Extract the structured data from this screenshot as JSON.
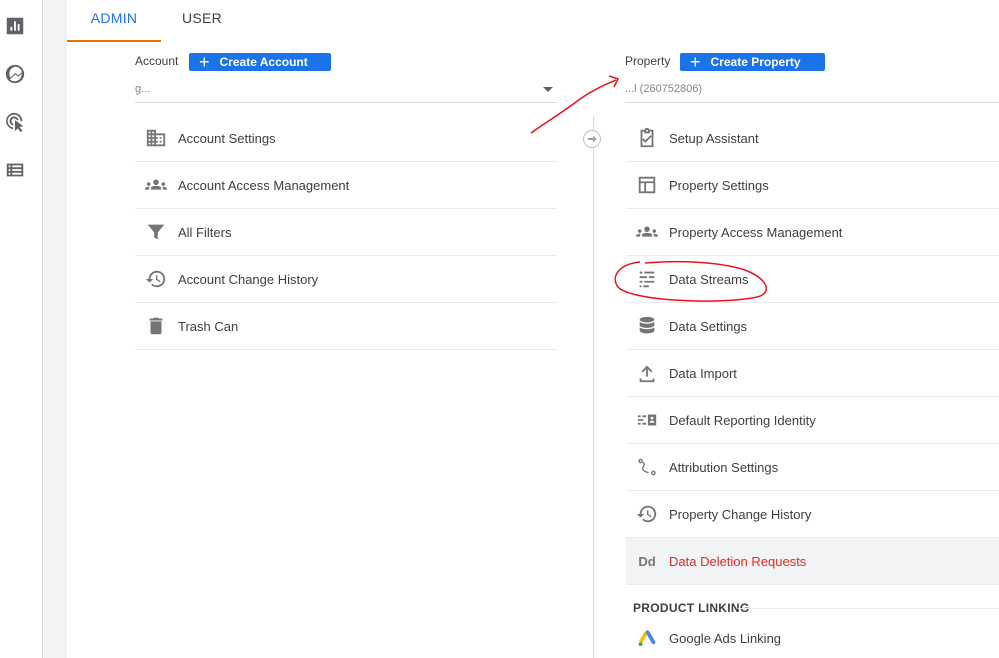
{
  "tabs": {
    "admin": "ADMIN",
    "user": "USER"
  },
  "account": {
    "label": "Account",
    "create_button": "Create Account",
    "selector_value": "g..."
  },
  "property": {
    "label": "Property",
    "create_button": "Create Property",
    "selector_value": "...l (260752806)"
  },
  "account_menu": [
    {
      "label": "Account Settings",
      "icon": "building-icon"
    },
    {
      "label": "Account Access Management",
      "icon": "people-icon"
    },
    {
      "label": "All Filters",
      "icon": "filter-icon"
    },
    {
      "label": "Account Change History",
      "icon": "history-icon"
    },
    {
      "label": "Trash Can",
      "icon": "trash-icon"
    }
  ],
  "property_menu": [
    {
      "label": "Setup Assistant",
      "icon": "checklist-icon"
    },
    {
      "label": "Property Settings",
      "icon": "layout-icon"
    },
    {
      "label": "Property Access Management",
      "icon": "people-icon"
    },
    {
      "label": "Data Streams",
      "icon": "streams-icon"
    },
    {
      "label": "Data Settings",
      "icon": "database-icon"
    },
    {
      "label": "Data Import",
      "icon": "upload-icon"
    },
    {
      "label": "Default Reporting Identity",
      "icon": "identity-icon"
    },
    {
      "label": "Attribution Settings",
      "icon": "attribution-icon"
    },
    {
      "label": "Property Change History",
      "icon": "history-icon"
    },
    {
      "label": "Data Deletion Requests",
      "icon": "dd-icon",
      "icon_text": "Dd"
    }
  ],
  "product_linking": {
    "title": "PRODUCT LINKING",
    "items": [
      {
        "label": "Google Ads Linking",
        "icon": "google-ads-icon"
      }
    ]
  },
  "colors": {
    "accent": "#1a73e8",
    "tab_indicator": "#e37400",
    "danger": "#d93025",
    "annotation": "#e8141c"
  }
}
